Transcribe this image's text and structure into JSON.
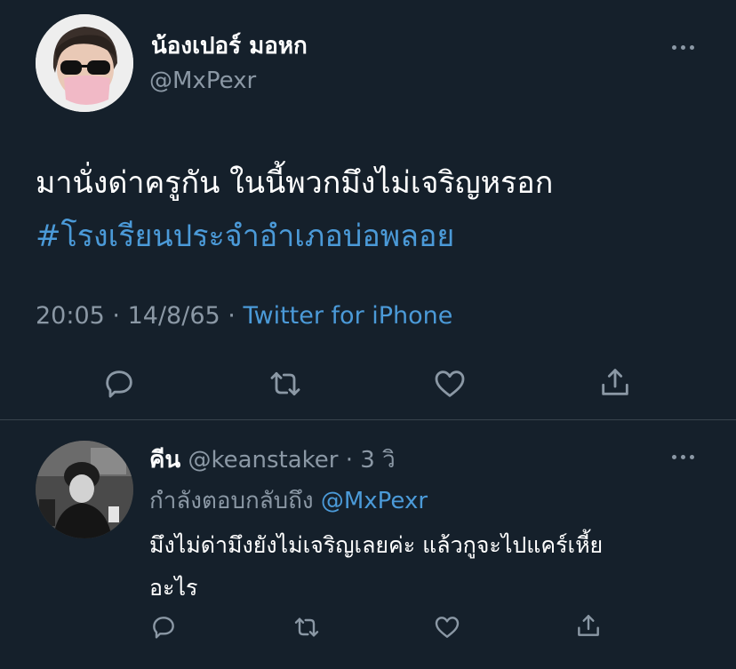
{
  "main_tweet": {
    "display_name": "น้องเปอร์ มอหก",
    "handle": "@MxPexr",
    "text": "มานั่งด่าครูกัน ในนี้พวกมึงไม่เจริญหรอก",
    "hashtag": "#โรงเรียนประจำอำเภอบ่อพลอย",
    "time": "20:05",
    "date": "14/8/65",
    "separator": "·",
    "source": "Twitter for iPhone"
  },
  "reply": {
    "display_name": "คีน",
    "handle": "@keanstaker",
    "separator": "·",
    "age": "3 วิ",
    "replying_to_prefix": "กำลังตอบกลับถึง",
    "replying_to_handle": "@MxPexr",
    "text_line1": "มึงไม่ด่ามึงยังไม่เจริญเลยค่ะ แล้วกูจะไปแคร์เหี้ย",
    "text_line2": "อะไร"
  },
  "colors": {
    "background": "#15202b",
    "text": "#ffffff",
    "muted": "#8b98a5",
    "link": "#4b9ad8"
  }
}
